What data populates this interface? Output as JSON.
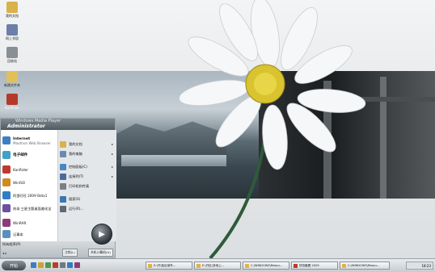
{
  "desktop_icons": [
    {
      "label": "我的文档",
      "icon": "documents-icon",
      "color": "#d9b24a"
    },
    {
      "label": "网上邻居",
      "icon": "network-icon",
      "color": "#6b7fa8"
    },
    {
      "label": "回收站",
      "icon": "recycle-bin-icon",
      "color": "#8a8f94"
    },
    {
      "label": "新建文件夹",
      "icon": "folder-icon",
      "color": "#e2c056"
    },
    {
      "label": "KanRider",
      "icon": "kanrider-icon",
      "color": "#b33a2a"
    }
  ],
  "start_menu": {
    "top_label": "Windows Media Player",
    "user_name": "Administrator",
    "left_items": [
      {
        "title": "Internet",
        "sub": "Maxthon Web Browser",
        "icon": "browser-icon",
        "color": "#3c7fc5"
      },
      {
        "title": "电子邮件",
        "sub": "",
        "icon": "email-icon",
        "color": "#3fa0c9"
      },
      {
        "title": "KanRider",
        "sub": "",
        "icon": "kanrider-icon",
        "color": "#c0392b"
      },
      {
        "title": "WinISO",
        "sub": "",
        "icon": "winiso-icon",
        "color": "#d28a1f"
      },
      {
        "title": "阿里旺旺 2009 Beta1",
        "sub": "",
        "icon": "wangwang-icon",
        "color": "#2f7dc3"
      },
      {
        "title": "刻录 三星主题桌面美化宝",
        "sub": "",
        "icon": "theme-icon",
        "color": "#6d4fa3"
      },
      {
        "title": "WinRAR",
        "sub": "",
        "icon": "winrar-icon",
        "color": "#8e3b7a"
      },
      {
        "title": "记事本",
        "sub": "",
        "icon": "notepad-icon",
        "color": "#5a8fbf"
      }
    ],
    "right_items": [
      {
        "label": "我的文档",
        "icon": "documents-icon",
        "color": "#d9b24a",
        "arrow": true
      },
      {
        "label": "我的电脑",
        "icon": "computer-icon",
        "color": "#6d8aa8",
        "arrow": true
      },
      {
        "label": "控制面板(C)",
        "icon": "control-panel-icon",
        "color": "#4a86c2",
        "arrow": true
      },
      {
        "label": "连接到(T)",
        "icon": "connect-icon",
        "color": "#4a6c9a",
        "arrow": true
      },
      {
        "label": "打印机和传真",
        "icon": "printer-icon",
        "color": "#7a7f85",
        "arrow": false
      },
      {
        "label": "搜索(S)",
        "icon": "search-icon",
        "color": "#3a77b5",
        "arrow": false
      },
      {
        "label": "运行(R)...",
        "icon": "run-icon",
        "color": "#5d6a74",
        "arrow": false
      }
    ],
    "all_programs": "所有程序(P)",
    "nav_label": "◂ ▸",
    "logoff": "注销(L)",
    "shutdown": "关机计算机(U)"
  },
  "taskbar": {
    "start_label": "开始",
    "tasks": [
      {
        "label": "E:\\开\\各区域专..."
      },
      {
        "label": "E:\\开区\\多地上..."
      },
      {
        "label": "C:\\WINDOWS\\Resou..."
      },
      {
        "label": "快览截图 2009"
      },
      {
        "label": "C:\\WINDOWS\\Resou..."
      }
    ],
    "clock": "18:23"
  }
}
